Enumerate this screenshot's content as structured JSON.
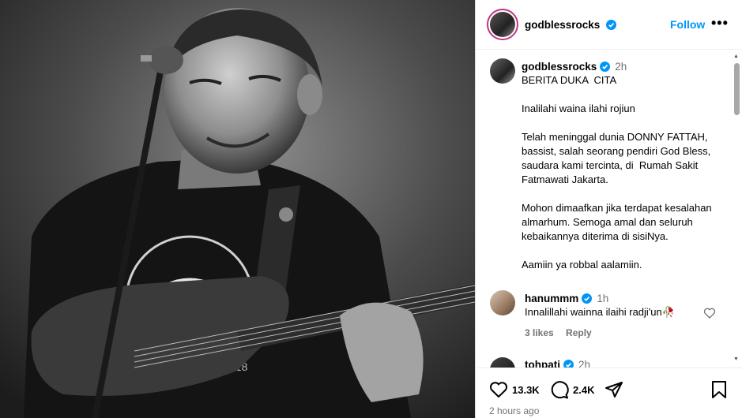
{
  "post": {
    "username": "godblessrocks",
    "follow_label": "Follow",
    "more_label": "•••"
  },
  "caption": {
    "username": "godblessrocks",
    "time": "2h",
    "text": "BERITA DUKA  CITA\n\nInalilahi waina ilahi rojiun\n\nTelah meninggal dunia DONNY FATTAH, bassist, salah seorang pendiri God Bless, saudara kami tercinta, di  Rumah Sakit Fatmawati Jakarta.\n\nMohon dimaafkan jika terdapat kesalahan almarhum. Semoga amal dan seluruh kebaikannya diterima di sisiNya.\n\nAamiin ya robbal aalamiin."
  },
  "comments": [
    {
      "username": "hanummm",
      "time": "1h",
      "text": "Innalillahi wainna ilaihi radji'un🥀",
      "likes": "3 likes",
      "reply_label": "Reply"
    },
    {
      "username": "tohpati",
      "time": "2h"
    }
  ],
  "actions": {
    "likes": "13.3K",
    "comments": "2.4K"
  },
  "posted_ago": "2 hours ago",
  "colors": {
    "accent": "#0095f6",
    "verified": "#0095f6",
    "muted": "#737373"
  },
  "icons": [
    "verified-icon",
    "more-icon",
    "heart-icon",
    "comment-icon",
    "share-icon",
    "bookmark-icon"
  ]
}
